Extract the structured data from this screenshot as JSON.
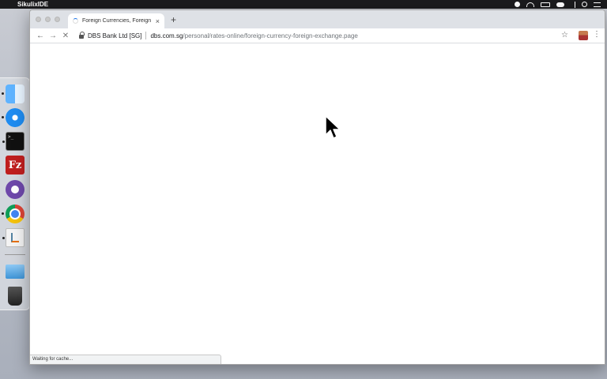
{
  "menubar": {
    "app_name": "SikulixIDE",
    "icons": [
      "record-icon",
      "wifi-icon",
      "battery-icon",
      "cloud-icon",
      "bluetooth-icon",
      "spotlight-icon",
      "control-center-icon"
    ]
  },
  "dock": {
    "apps": [
      "Finder",
      "Safari",
      "Terminal",
      "FileZilla",
      "GitHub Desktop",
      "Google Chrome",
      "Java",
      "Applications",
      "Trash"
    ]
  },
  "browser": {
    "tab": {
      "title": "Foreign Currencies, Foreign Exchange",
      "close_glyph": "×"
    },
    "new_tab_glyph": "+",
    "nav": {
      "back_glyph": "←",
      "forward_glyph": "→",
      "stop_glyph": "✕"
    },
    "address": {
      "cert_name": "DBS Bank Ltd [SG]",
      "domain": "dbs.com.sg",
      "path": "/personal/rates-online/foreign-currency-foreign-exchange.page"
    },
    "bookmark_glyph": "☆",
    "menu_glyph": "⋮",
    "status_text": "Waiting for cache..."
  },
  "colors": {
    "accent": "#1a73e8",
    "tabstrip": "#dee1e6",
    "menubar": "#1b1b1d"
  }
}
